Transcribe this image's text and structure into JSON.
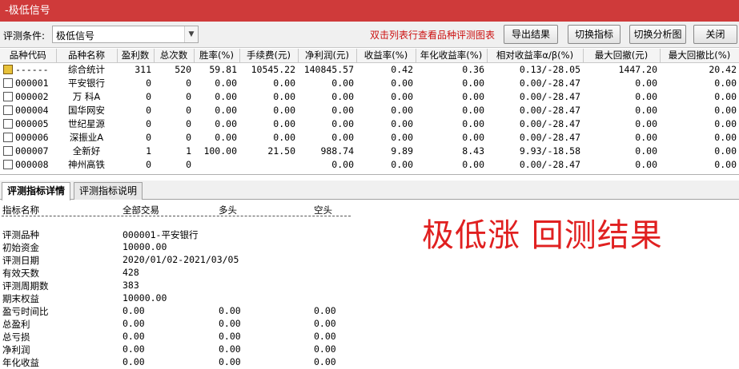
{
  "window": {
    "title": "-极低信号"
  },
  "toolbar": {
    "condition_label": "评测条件:",
    "condition_value": "极低信号",
    "hint": "双击列表行查看品种评测图表",
    "export_label": "导出结果",
    "switch_indicator_label": "切换指标",
    "switch_chart_label": "切换分析图",
    "close_label": "关闭"
  },
  "grid": {
    "headers": [
      "品种代码",
      "品种名称",
      "盈利数",
      "总次数",
      "胜率(%)",
      "手续费(元)",
      "净利润(元)",
      "收益率(%)",
      "年化收益率(%)",
      "相对收益率α/β(%)",
      "最大回撤(元)",
      "最大回撤比(%)"
    ],
    "rows": [
      [
        "------",
        "综合统计",
        "311",
        "520",
        "59.81",
        "10545.22",
        "140845.57",
        "0.42",
        "0.36",
        "0.13/-28.05",
        "1447.20",
        "20.42"
      ],
      [
        "000001",
        "平安银行",
        "0",
        "0",
        "0.00",
        "0.00",
        "0.00",
        "0.00",
        "0.00",
        "0.00/-28.47",
        "0.00",
        "0.00"
      ],
      [
        "000002",
        "万 科A",
        "0",
        "0",
        "0.00",
        "0.00",
        "0.00",
        "0.00",
        "0.00",
        "0.00/-28.47",
        "0.00",
        "0.00"
      ],
      [
        "000004",
        "国华网安",
        "0",
        "0",
        "0.00",
        "0.00",
        "0.00",
        "0.00",
        "0.00",
        "0.00/-28.47",
        "0.00",
        "0.00"
      ],
      [
        "000005",
        "世纪星源",
        "0",
        "0",
        "0.00",
        "0.00",
        "0.00",
        "0.00",
        "0.00",
        "0.00/-28.47",
        "0.00",
        "0.00"
      ],
      [
        "000006",
        "深振业A",
        "0",
        "0",
        "0.00",
        "0.00",
        "0.00",
        "0.00",
        "0.00",
        "0.00/-28.47",
        "0.00",
        "0.00"
      ],
      [
        "000007",
        "全新好",
        "1",
        "1",
        "100.00",
        "21.50",
        "988.74",
        "9.89",
        "8.43",
        "9.93/-18.58",
        "0.00",
        "0.00"
      ],
      [
        "000008",
        "神州高铁",
        "0",
        "0",
        "",
        "",
        "0.00",
        "0.00",
        "0.00",
        "0.00/-28.47",
        "0.00",
        "0.00"
      ]
    ]
  },
  "tabs": [
    "评测指标详情",
    "评测指标说明"
  ],
  "detail": {
    "header": [
      "指标名称",
      "全部交易",
      "多头",
      "空头"
    ],
    "rows": [
      [
        "评测品种",
        "000001-平安银行",
        "",
        ""
      ],
      [
        "初始资金",
        "10000.00",
        "",
        ""
      ],
      [
        "评测日期",
        "2020/01/02-2021/03/05",
        "",
        ""
      ],
      [
        "有效天数",
        "428",
        "",
        ""
      ],
      [
        "评测周期数",
        "383",
        "",
        ""
      ],
      [
        "期末权益",
        "10000.00",
        "",
        ""
      ],
      [
        "盈亏时间比",
        "0.00",
        "0.00",
        "0.00"
      ],
      [
        "总盈利",
        "0.00",
        "0.00",
        "0.00"
      ],
      [
        "总亏损",
        "0.00",
        "0.00",
        "0.00"
      ],
      [
        "净利润",
        "0.00",
        "0.00",
        "0.00"
      ],
      [
        "年化收益",
        "0.00",
        "0.00",
        "0.00"
      ]
    ]
  },
  "banner": "极低涨  回测结果",
  "colors": {
    "titlebar": "#cf3a3a",
    "hint": "#cc1111",
    "banner": "#e02020"
  }
}
